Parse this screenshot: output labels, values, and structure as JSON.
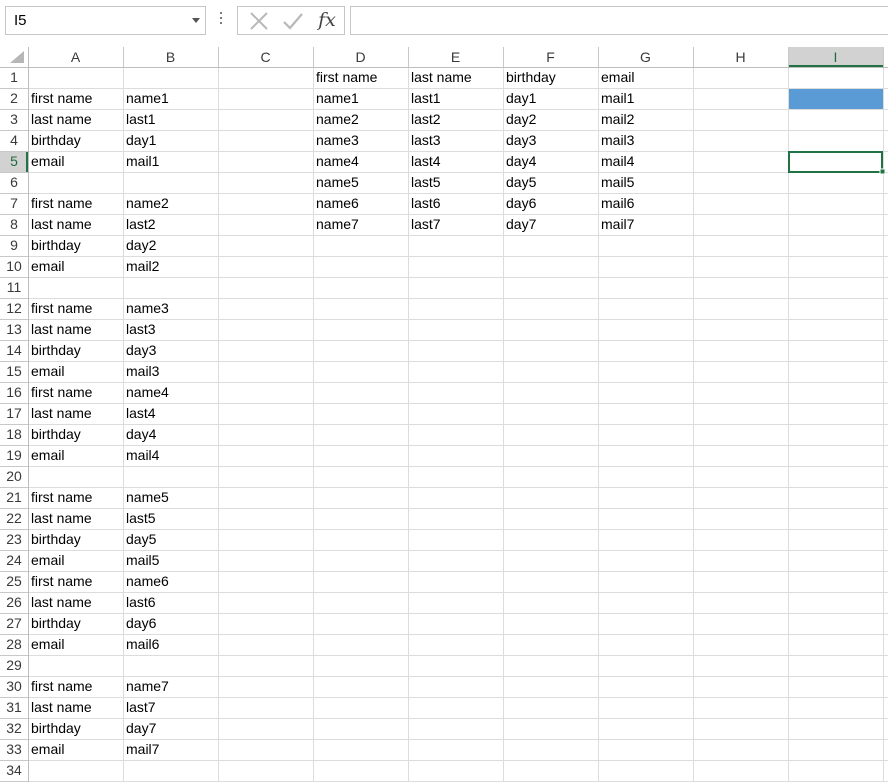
{
  "name_box": {
    "value": "I5",
    "dropdown_icon": "chevron-down-icon"
  },
  "formula_bar": {
    "cancel_icon": "cancel-icon",
    "enter_icon": "checkmark-icon",
    "fx_label": "fx",
    "content": ""
  },
  "sheet": {
    "active_cell": "I5",
    "active_column": "I",
    "active_row": 5,
    "filled_cell": "I2",
    "filled_color": "#5b9bd5",
    "selection_border_color": "#217346",
    "columns": [
      "A",
      "B",
      "C",
      "D",
      "E",
      "F",
      "G",
      "H",
      "I"
    ],
    "rows": [
      "1",
      "2",
      "3",
      "4",
      "5",
      "6",
      "7",
      "8",
      "9",
      "10",
      "11",
      "12",
      "13",
      "14",
      "15",
      "16",
      "17",
      "18",
      "19",
      "20",
      "21",
      "22",
      "23",
      "24",
      "25",
      "26",
      "27",
      "28",
      "29",
      "30",
      "31",
      "32",
      "33",
      "34"
    ],
    "cells": [
      {
        "ref": "D1",
        "value": "first name"
      },
      {
        "ref": "E1",
        "value": "last name"
      },
      {
        "ref": "F1",
        "value": "birthday"
      },
      {
        "ref": "G1",
        "value": "email"
      },
      {
        "ref": "A2",
        "value": "first name"
      },
      {
        "ref": "B2",
        "value": "name1"
      },
      {
        "ref": "D2",
        "value": "name1"
      },
      {
        "ref": "E2",
        "value": "last1"
      },
      {
        "ref": "F2",
        "value": "day1"
      },
      {
        "ref": "G2",
        "value": "mail1"
      },
      {
        "ref": "A3",
        "value": "last name"
      },
      {
        "ref": "B3",
        "value": "last1"
      },
      {
        "ref": "D3",
        "value": "name2"
      },
      {
        "ref": "E3",
        "value": "last2"
      },
      {
        "ref": "F3",
        "value": "day2"
      },
      {
        "ref": "G3",
        "value": "mail2"
      },
      {
        "ref": "A4",
        "value": "birthday"
      },
      {
        "ref": "B4",
        "value": "day1"
      },
      {
        "ref": "D4",
        "value": "name3"
      },
      {
        "ref": "E4",
        "value": "last3"
      },
      {
        "ref": "F4",
        "value": "day3"
      },
      {
        "ref": "G4",
        "value": "mail3"
      },
      {
        "ref": "A5",
        "value": "email"
      },
      {
        "ref": "B5",
        "value": "mail1"
      },
      {
        "ref": "D5",
        "value": "name4"
      },
      {
        "ref": "E5",
        "value": "last4"
      },
      {
        "ref": "F5",
        "value": "day4"
      },
      {
        "ref": "G5",
        "value": "mail4"
      },
      {
        "ref": "D6",
        "value": "name5"
      },
      {
        "ref": "E6",
        "value": "last5"
      },
      {
        "ref": "F6",
        "value": "day5"
      },
      {
        "ref": "G6",
        "value": "mail5"
      },
      {
        "ref": "A7",
        "value": "first name"
      },
      {
        "ref": "B7",
        "value": "name2"
      },
      {
        "ref": "D7",
        "value": "name6"
      },
      {
        "ref": "E7",
        "value": "last6"
      },
      {
        "ref": "F7",
        "value": "day6"
      },
      {
        "ref": "G7",
        "value": "mail6"
      },
      {
        "ref": "A8",
        "value": "last name"
      },
      {
        "ref": "B8",
        "value": "last2"
      },
      {
        "ref": "D8",
        "value": "name7"
      },
      {
        "ref": "E8",
        "value": "last7"
      },
      {
        "ref": "F8",
        "value": "day7"
      },
      {
        "ref": "G8",
        "value": "mail7"
      },
      {
        "ref": "A9",
        "value": "birthday"
      },
      {
        "ref": "B9",
        "value": "day2"
      },
      {
        "ref": "A10",
        "value": "email"
      },
      {
        "ref": "B10",
        "value": "mail2"
      },
      {
        "ref": "A12",
        "value": "first name"
      },
      {
        "ref": "B12",
        "value": "name3"
      },
      {
        "ref": "A13",
        "value": "last name"
      },
      {
        "ref": "B13",
        "value": "last3"
      },
      {
        "ref": "A14",
        "value": "birthday"
      },
      {
        "ref": "B14",
        "value": "day3"
      },
      {
        "ref": "A15",
        "value": "email"
      },
      {
        "ref": "B15",
        "value": "mail3"
      },
      {
        "ref": "A16",
        "value": "first name"
      },
      {
        "ref": "B16",
        "value": "name4"
      },
      {
        "ref": "A17",
        "value": "last name"
      },
      {
        "ref": "B17",
        "value": "last4"
      },
      {
        "ref": "A18",
        "value": "birthday"
      },
      {
        "ref": "B18",
        "value": "day4"
      },
      {
        "ref": "A19",
        "value": "email"
      },
      {
        "ref": "B19",
        "value": "mail4"
      },
      {
        "ref": "A21",
        "value": "first name"
      },
      {
        "ref": "B21",
        "value": "name5"
      },
      {
        "ref": "A22",
        "value": "last name"
      },
      {
        "ref": "B22",
        "value": "last5"
      },
      {
        "ref": "A23",
        "value": "birthday"
      },
      {
        "ref": "B23",
        "value": "day5"
      },
      {
        "ref": "A24",
        "value": "email"
      },
      {
        "ref": "B24",
        "value": "mail5"
      },
      {
        "ref": "A25",
        "value": "first name"
      },
      {
        "ref": "B25",
        "value": "name6"
      },
      {
        "ref": "A26",
        "value": "last name"
      },
      {
        "ref": "B26",
        "value": "last6"
      },
      {
        "ref": "A27",
        "value": "birthday"
      },
      {
        "ref": "B27",
        "value": "day6"
      },
      {
        "ref": "A28",
        "value": "email"
      },
      {
        "ref": "B28",
        "value": "mail6"
      },
      {
        "ref": "A30",
        "value": "first name"
      },
      {
        "ref": "B30",
        "value": "name7"
      },
      {
        "ref": "A31",
        "value": "last name"
      },
      {
        "ref": "B31",
        "value": "last7"
      },
      {
        "ref": "A32",
        "value": "birthday"
      },
      {
        "ref": "B32",
        "value": "day7"
      },
      {
        "ref": "A33",
        "value": "email"
      },
      {
        "ref": "B33",
        "value": "mail7"
      }
    ]
  }
}
